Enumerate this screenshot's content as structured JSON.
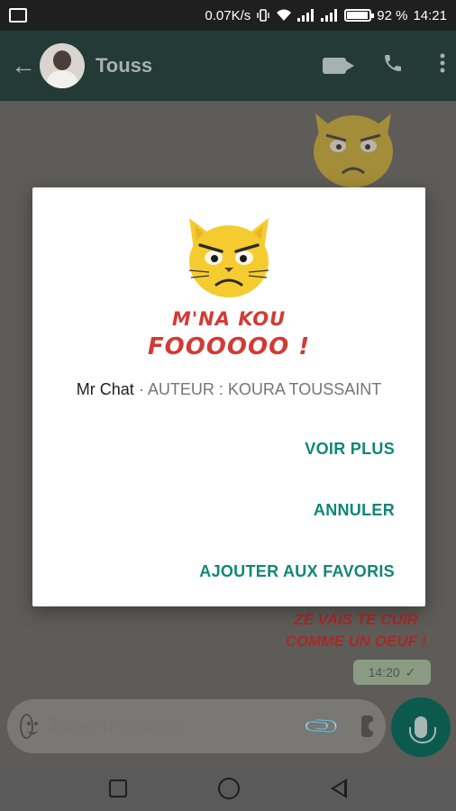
{
  "status_bar": {
    "speed": "0.07K/s",
    "battery": "92 %",
    "time": "14:21"
  },
  "chat": {
    "title": "Touss",
    "message_time": "14:20",
    "sticker_text_line1": "ZE VAIS TE CUIR",
    "sticker_text_line2": "COMME UN OEUF !"
  },
  "input": {
    "placeholder": "Taper message"
  },
  "dialog": {
    "sticker_line1": "M'NA KOU",
    "sticker_line2": "FOOOOOO !",
    "pack_name": "Mr Chat",
    "separator": "·",
    "author": "AUTEUR : KOURA TOUSSAINT",
    "voir_plus": "VOIR PLUS",
    "annuler": "ANNULER",
    "ajouter": "AJOUTER AUX FAVORIS"
  },
  "colors": {
    "accent": "#0f8774",
    "sticker_red": "#d33a35",
    "header": "#233a37"
  }
}
